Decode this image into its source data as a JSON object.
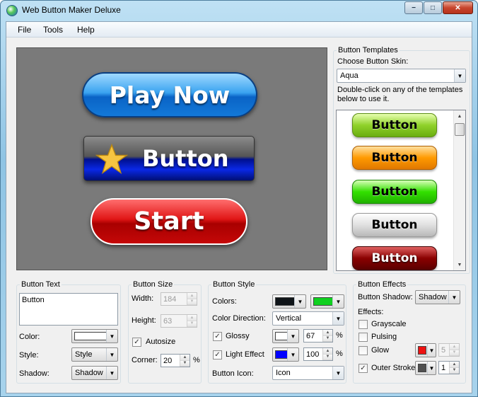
{
  "window": {
    "title": "Web Button Maker Deluxe",
    "minimize": "−",
    "maximize": "□",
    "close": "✕"
  },
  "menu": [
    "File",
    "Tools",
    "Help"
  ],
  "preview": {
    "buttons": [
      {
        "label": "Play Now",
        "style": "aqua-blue",
        "color": "#1379d8"
      },
      {
        "label": "Button",
        "style": "glass-blue",
        "icon": "star-icon",
        "color": "#0a28e6"
      },
      {
        "label": "Start",
        "style": "pill-red",
        "color": "#c40808"
      }
    ]
  },
  "templates": {
    "legend": "Button Templates",
    "skin_label": "Choose Button Skin:",
    "skin_value": "Aqua",
    "hint": "Double-click on any of the templates below to use it.",
    "items": [
      {
        "label": "Button",
        "color": "#8fd12a"
      },
      {
        "label": "Button",
        "color": "#ff9a00"
      },
      {
        "label": "Button",
        "color": "#33e000"
      },
      {
        "label": "Button",
        "color": "#cfcfcf"
      },
      {
        "label": "Button",
        "color": "#8a0000"
      }
    ]
  },
  "button_text": {
    "legend": "Button Text",
    "text": "Button",
    "color_label": "Color:",
    "style_label": "Style:",
    "style_value": "Style",
    "shadow_label": "Shadow:",
    "shadow_value": "Shadow",
    "color_value": "#ffffff"
  },
  "button_size": {
    "legend": "Button Size",
    "width_label": "Width:",
    "width_value": "184",
    "height_label": "Height:",
    "height_value": "63",
    "autosize_label": "Autosize",
    "autosize_checked": true,
    "corner_label": "Corner:",
    "corner_value": "20",
    "percent": "%"
  },
  "button_style": {
    "legend": "Button Style",
    "colors_label": "Colors:",
    "color1": "#0f1418",
    "color2": "#10d020",
    "direction_label": "Color Direction:",
    "direction_value": "Vertical",
    "glossy_label": "Glossy",
    "glossy_checked": true,
    "glossy_color": "#ffffff",
    "glossy_value": "67",
    "light_label": "Light Effect",
    "light_checked": true,
    "light_color": "#0000ff",
    "light_value": "100",
    "icon_label": "Button Icon:",
    "icon_value": "Icon",
    "percent": "%"
  },
  "button_effects": {
    "legend": "Button Effects",
    "shadow_label": "Button Shadow:",
    "shadow_value": "Shadow",
    "effects_label": "Effects:",
    "grayscale_label": "Grayscale",
    "pulsing_label": "Pulsing",
    "glow_label": "Glow",
    "glow_color": "#ee1111",
    "glow_value": "5",
    "outer_label": "Outer Stroke",
    "outer_checked": true,
    "outer_color": "#505050",
    "outer_value": "1"
  }
}
